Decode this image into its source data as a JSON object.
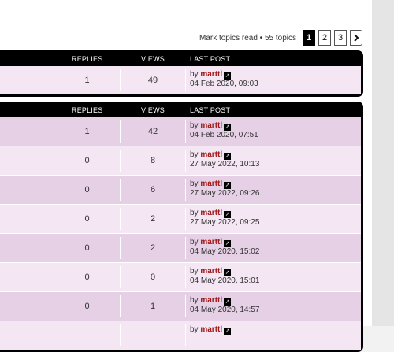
{
  "action_bar": {
    "mark_read": "Mark topics read",
    "separator": "•",
    "topic_count": "55 topics",
    "pages": [
      "1",
      "2",
      "3"
    ],
    "current_page": "1",
    "next_icon": "chevron-right-icon"
  },
  "columns": {
    "replies": "REPLIES",
    "views": "VIEWS",
    "last_post": "LAST POST"
  },
  "announcements": [
    {
      "replies": "1",
      "views": "49",
      "by": "by",
      "author": "marttl",
      "date": "04 Feb 2020, 09:03"
    }
  ],
  "topics": [
    {
      "replies": "1",
      "views": "42",
      "by": "by",
      "author": "marttl",
      "date": "04 Feb 2020, 07:51"
    },
    {
      "replies": "0",
      "views": "8",
      "by": "by",
      "author": "marttl",
      "date": "27 May 2022, 10:13"
    },
    {
      "replies": "0",
      "views": "6",
      "by": "by",
      "author": "marttl",
      "date": "27 May 2022, 09:26"
    },
    {
      "replies": "0",
      "views": "2",
      "by": "by",
      "author": "marttl",
      "date": "27 May 2022, 09:25"
    },
    {
      "replies": "0",
      "views": "2",
      "by": "by",
      "author": "marttl",
      "date": "04 May 2020, 15:02"
    },
    {
      "replies": "0",
      "views": "0",
      "by": "by",
      "author": "marttl",
      "date": "04 May 2020, 15:01"
    },
    {
      "replies": "0",
      "views": "1",
      "by": "by",
      "author": "marttl",
      "date": "04 May 2020, 14:57"
    },
    {
      "replies": "",
      "views": "",
      "by": "by",
      "author": "marttl",
      "date": ""
    }
  ],
  "colors": {
    "row_light": "#f4e6f3",
    "row_dark": "#e6d0e5",
    "author": "#a01818",
    "header": "#000000"
  }
}
